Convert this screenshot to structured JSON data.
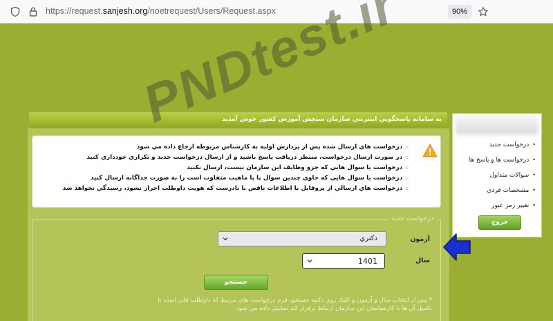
{
  "browser": {
    "url_prefix": "https://request.",
    "url_domain": "sanjesh.org",
    "url_path": "/noetrequest/Users/Request.aspx",
    "zoom": "90%"
  },
  "sidebar": {
    "items": [
      {
        "label": "درخواست جديد"
      },
      {
        "label": "درخواست ها و پاسخ ها"
      },
      {
        "label": "سوالات متداول"
      },
      {
        "label": "مشخصات فردي"
      },
      {
        "label": "تغيير رمز عبور"
      }
    ],
    "exit_label": "خروج"
  },
  "header": {
    "welcome": "به سامانه پاسخگويي اينترنتي سازمان سنجش آموزش کشور خوش آمديد"
  },
  "notices": [
    "درخواست هاي ارسال شده پس از پردازش اوليه به كارشناس مربوطه ارجاع داده مي شود",
    "در صورت ارسال درخواست، منتظر دريافت پاسخ باشيد و از ارسال درخواست جديد و تكراري خودداري كنيد",
    "درخواست يا سوال هايي كه جزو وظايف اين سازمان نيست، ارسال نكنيد",
    "درخواست يا سوال هايي كه حاوي چندين سوال با با ماهيت متفاوت است را به صورت جداگانه ارسال كنيد",
    "درخواست هاي ارسالي از پروفايل با اطلاعات ناقص يا نادرست كه هويت داوطلب احراز نشود، رسيدگي نخواهد شد"
  ],
  "request_form": {
    "legend": "درخواست جديد",
    "exam_label": "آزمون",
    "exam_value": "دكتري",
    "year_label": "سال",
    "year_value": "1401",
    "search_label": "جستجو",
    "hint": "* پس از انتخاب سال و آزمون و كليك روي دكمه جستجو، فرم درخواست هاي مرتبط كه داوطلب قادر است با تكميل آن ها با كارشناسان اين سازمان ارتباط برقرار كند نمايش داده مي شود"
  },
  "watermark": "PNDtest.ir",
  "colors": {
    "page_bg": "#9aae32",
    "panel_bg": "#b4c459",
    "button_green": "#64a82a",
    "arrow_blue": "#1a2fd0"
  },
  "icons": [
    "shield-icon",
    "lock-icon",
    "star-icon",
    "warning-icon",
    "chevron-down-icon",
    "arrow-icon"
  ]
}
